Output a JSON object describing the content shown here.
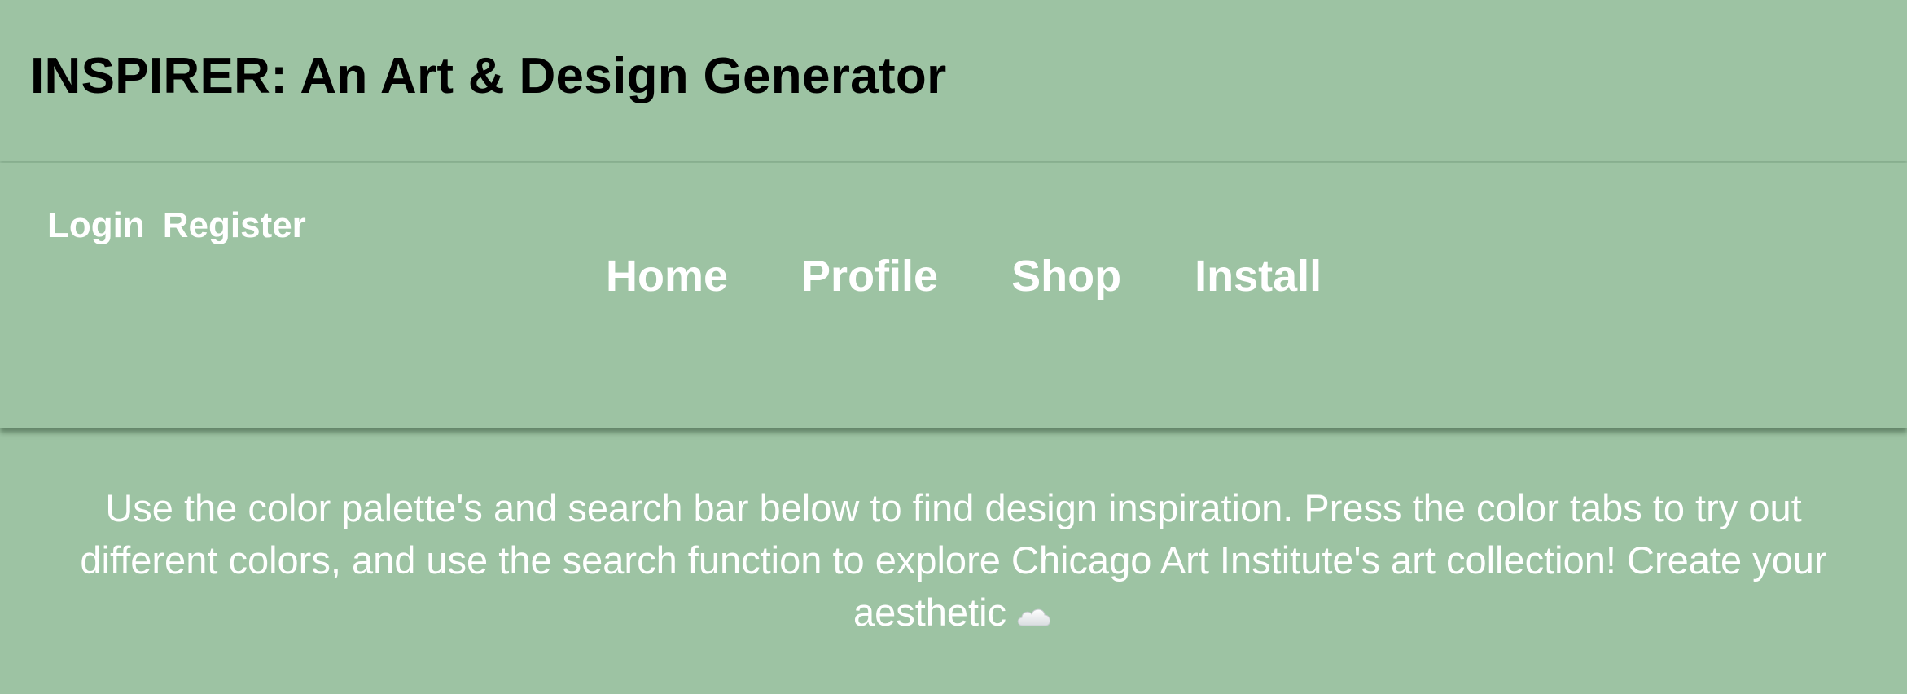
{
  "header": {
    "title": "INSPIRER: An Art & Design Generator"
  },
  "auth": {
    "login_label": "Login",
    "register_label": "Register"
  },
  "nav": {
    "items": [
      {
        "label": "Home"
      },
      {
        "label": "Profile"
      },
      {
        "label": "Shop"
      },
      {
        "label": "Install"
      }
    ]
  },
  "intro": {
    "text": "Use the color palette's and search bar below to find design inspiration. Press the color tabs to try out different colors, and use the search function to explore Chicago Art Institute's art collection! Create your aesthetic",
    "icon": "cloud-icon"
  },
  "colors": {
    "background": "#9dc3a3",
    "nav_text": "#ffffff",
    "title_text": "#000000"
  }
}
